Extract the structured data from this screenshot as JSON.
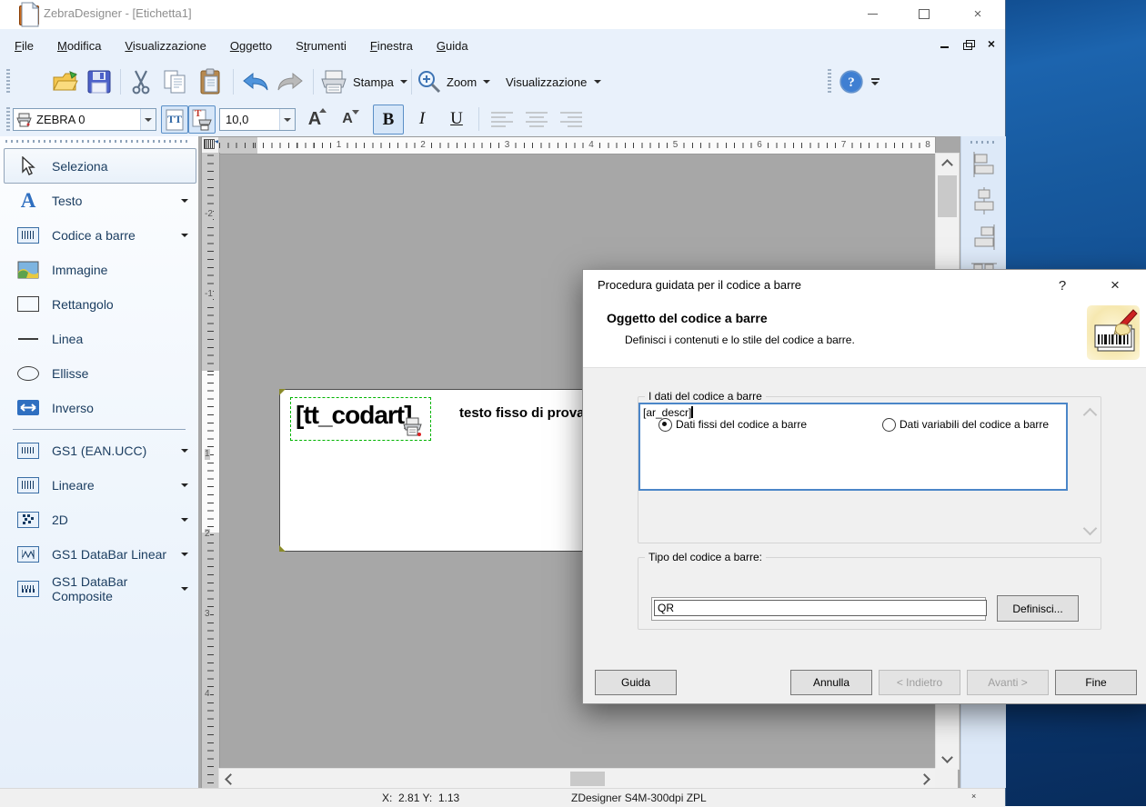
{
  "window": {
    "title": "ZebraDesigner - [Etichetta1]"
  },
  "icons": {
    "close_glyph": "×",
    "help_glyph": "?",
    "font_dialog_toggle": "TT",
    "text_print_toggle": "T",
    "font_up": "A",
    "font_down": "A",
    "statusbar_close": "×"
  },
  "menu": {
    "items": [
      {
        "label": "File",
        "u": 0
      },
      {
        "label": "Modifica",
        "u": 0
      },
      {
        "label": "Visualizzazione",
        "u": 0
      },
      {
        "label": "Oggetto",
        "u": 0
      },
      {
        "label": "Strumenti",
        "u": 1
      },
      {
        "label": "Finestra",
        "u": 0
      },
      {
        "label": "Guida",
        "u": 0
      }
    ]
  },
  "toolbar": {
    "print": "Stampa",
    "zoom": "Zoom",
    "view": "Visualizzazione"
  },
  "format_bar": {
    "printer": "ZEBRA 0",
    "font_size": "10,0",
    "bold": "B",
    "italic": "I",
    "underline": "U"
  },
  "sidebar": {
    "items": [
      {
        "label": "Seleziona"
      },
      {
        "label": "Testo"
      },
      {
        "label": "Codice a barre"
      },
      {
        "label": "Immagine"
      },
      {
        "label": "Rettangolo"
      },
      {
        "label": "Linea"
      },
      {
        "label": "Ellisse"
      },
      {
        "label": "Inverso"
      },
      {
        "label": "GS1 (EAN.UCC)"
      },
      {
        "label": "Lineare"
      },
      {
        "label": "2D"
      },
      {
        "label": "GS1 DataBar Linear"
      },
      {
        "label": "GS1 DataBar Composite"
      }
    ]
  },
  "rulers": {
    "horizontal": [
      1,
      2,
      3,
      4,
      5,
      6,
      7,
      8
    ],
    "vertical": [
      -2,
      -1,
      1,
      2,
      3,
      4
    ]
  },
  "canvas": {
    "selected_object_text": "[tt_codart]",
    "static_text": "testo fisso di prova"
  },
  "dialog": {
    "title": "Procedura guidata per il codice a barre",
    "header": {
      "title": "Oggetto del codice a barre",
      "subtitle": "Definisci i contenuti e lo stile del codice a barre."
    },
    "data_group": {
      "legend": "I dati del codice a barre",
      "fixed_option": "Dati fissi del codice a barre",
      "variable_option": "Dati variabili del codice a barre",
      "value": "[ar_descr]"
    },
    "type_group": {
      "legend": "Tipo del codice a barre:",
      "value": "QR",
      "define_button": "Definisci..."
    },
    "buttons": {
      "help": "Guida",
      "cancel": "Annulla",
      "back": "< Indietro",
      "next": "Avanti >",
      "finish": "Fine"
    }
  },
  "statusbar": {
    "coordinates": "X:  2.81 Y:  1.13",
    "printer": "ZDesigner S4M-300dpi ZPL"
  },
  "colors": {
    "accent_blue": "#4b86c8",
    "desktop_blue": "#155397",
    "selection_green": "#00b400"
  }
}
